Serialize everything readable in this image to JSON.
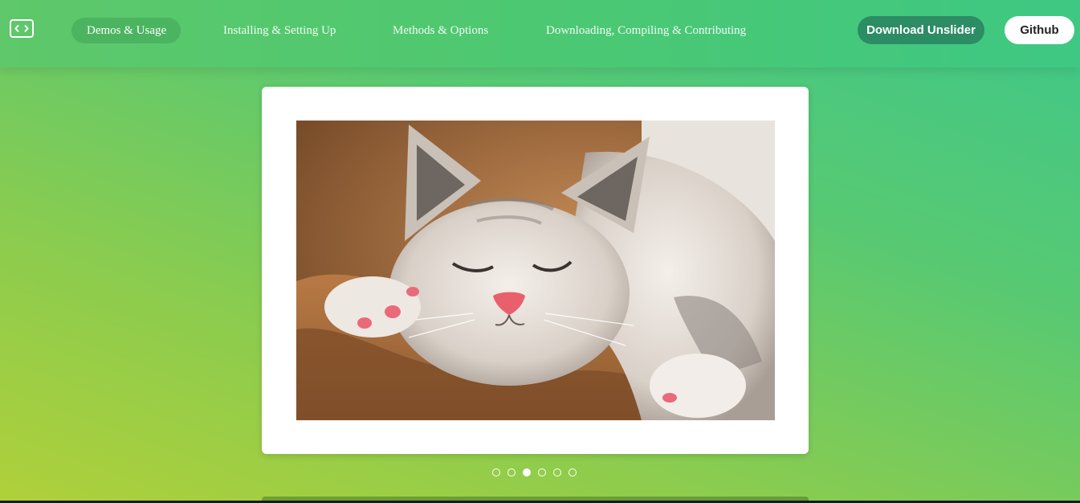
{
  "nav": {
    "logo_icon": "code-brackets-icon",
    "items": [
      {
        "label": "Demos & Usage",
        "active": true
      },
      {
        "label": "Installing & Setting Up",
        "active": false
      },
      {
        "label": "Methods & Options",
        "active": false
      },
      {
        "label": "Downloading, Compiling & Contributing",
        "active": false
      }
    ],
    "download_label": "Download Unslider",
    "github_label": "Github"
  },
  "slider": {
    "image_subject": "sleeping kitten on brown blanket",
    "slide_count": 6,
    "active_index": 2
  },
  "colors": {
    "accent": "#2c8c64",
    "gradient_top": "#3ec88a",
    "gradient_bottom": "#b0d03a"
  }
}
